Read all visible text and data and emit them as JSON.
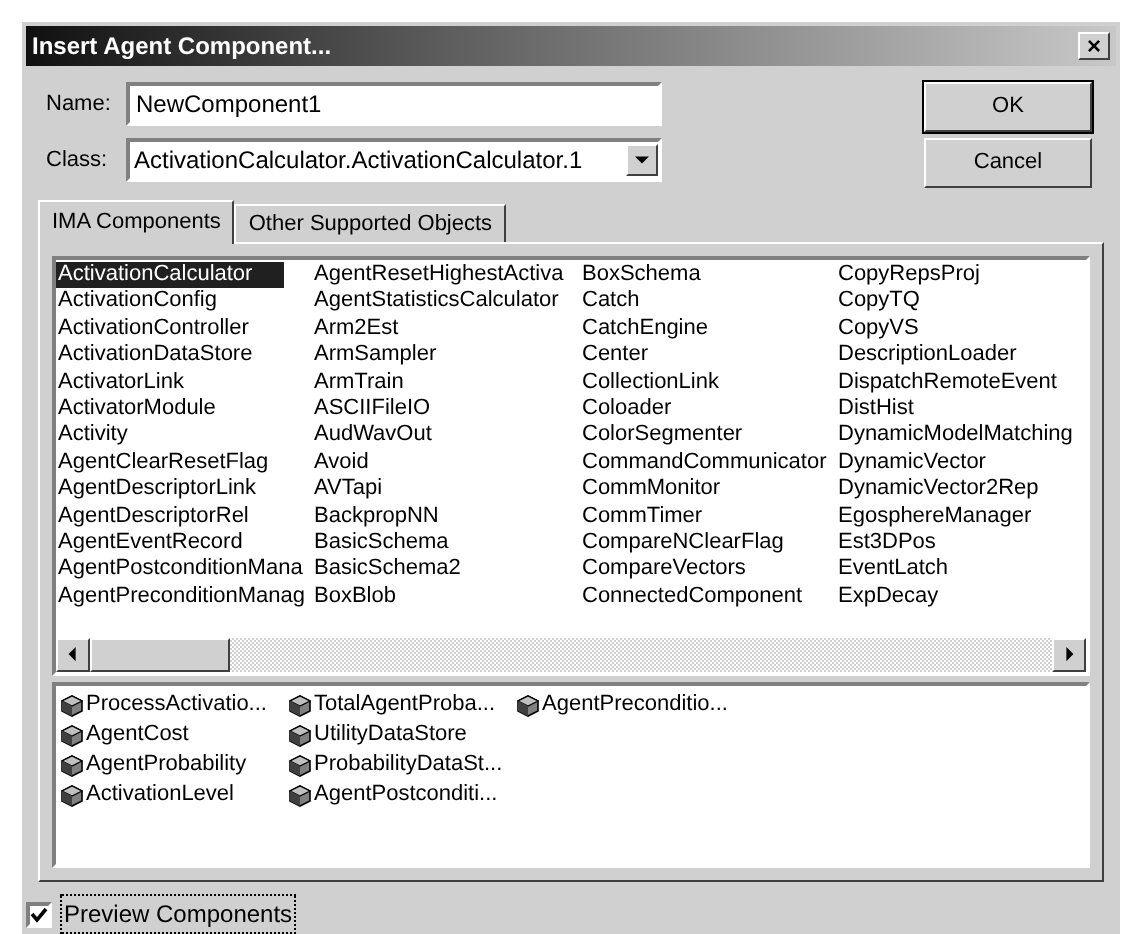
{
  "window": {
    "title": "Insert Agent Component...",
    "close": "×"
  },
  "name_field": {
    "label": "Name:",
    "value": "NewComponent1"
  },
  "class_field": {
    "label": "Class:",
    "value": "ActivationCalculator.ActivationCalculator.1"
  },
  "buttons": [
    "OK",
    "Cancel"
  ],
  "tabs": [
    {
      "label": "IMA Components",
      "selected": true
    },
    {
      "label": "Other Supported Objects",
      "selected": false
    }
  ],
  "component_list": {
    "columns": [
      [
        {
          "label": "ActivationCalculator",
          "selected": true
        },
        {
          "label": "ActivationConfig",
          "selected": false
        },
        {
          "label": "ActivationController",
          "selected": false
        },
        {
          "label": "ActivationDataStore",
          "selected": false
        },
        {
          "label": "ActivatorLink",
          "selected": false
        },
        {
          "label": "ActivatorModule",
          "selected": false
        },
        {
          "label": "Activity",
          "selected": false
        },
        {
          "label": "AgentClearResetFlag",
          "selected": false
        },
        {
          "label": "AgentDescriptorLink",
          "selected": false
        },
        {
          "label": "AgentDescriptorRel",
          "selected": false
        },
        {
          "label": "AgentEventRecord",
          "selected": false
        },
        {
          "label": "AgentPostconditionMana",
          "selected": false
        },
        {
          "label": "AgentPreconditionManag",
          "selected": false
        }
      ],
      [
        {
          "label": "AgentResetHighestActiva",
          "selected": false
        },
        {
          "label": "AgentStatisticsCalculator",
          "selected": false
        },
        {
          "label": "Arm2Est",
          "selected": false
        },
        {
          "label": "ArmSampler",
          "selected": false
        },
        {
          "label": "ArmTrain",
          "selected": false
        },
        {
          "label": "ASCIIFileIO",
          "selected": false
        },
        {
          "label": "AudWavOut",
          "selected": false
        },
        {
          "label": "Avoid",
          "selected": false
        },
        {
          "label": "AVTapi",
          "selected": false
        },
        {
          "label": "BackpropNN",
          "selected": false
        },
        {
          "label": "BasicSchema",
          "selected": false
        },
        {
          "label": "BasicSchema2",
          "selected": false
        },
        {
          "label": "BoxBlob",
          "selected": false
        }
      ],
      [
        {
          "label": "BoxSchema",
          "selected": false
        },
        {
          "label": "Catch",
          "selected": false
        },
        {
          "label": "CatchEngine",
          "selected": false
        },
        {
          "label": "Center",
          "selected": false
        },
        {
          "label": "CollectionLink",
          "selected": false
        },
        {
          "label": "Coloader",
          "selected": false
        },
        {
          "label": "ColorSegmenter",
          "selected": false
        },
        {
          "label": "CommandCommunicator",
          "selected": false
        },
        {
          "label": "CommMonitor",
          "selected": false
        },
        {
          "label": "CommTimer",
          "selected": false
        },
        {
          "label": "CompareNClearFlag",
          "selected": false
        },
        {
          "label": "CompareVectors",
          "selected": false
        },
        {
          "label": "ConnectedComponent",
          "selected": false
        }
      ],
      [
        {
          "label": "CopyRepsProj",
          "selected": false
        },
        {
          "label": "CopyTQ",
          "selected": false
        },
        {
          "label": "CopyVS",
          "selected": false
        },
        {
          "label": "DescriptionLoader",
          "selected": false
        },
        {
          "label": "DispatchRemoteEvent",
          "selected": false
        },
        {
          "label": "DistHist",
          "selected": false
        },
        {
          "label": "DynamicModelMatching",
          "selected": false
        },
        {
          "label": "DynamicVector",
          "selected": false
        },
        {
          "label": "DynamicVector2Rep",
          "selected": false
        },
        {
          "label": "EgosphereManager",
          "selected": false
        },
        {
          "label": "Est3DPos",
          "selected": false
        },
        {
          "label": "EventLatch",
          "selected": false
        },
        {
          "label": "ExpDecay",
          "selected": false
        }
      ]
    ]
  },
  "preview_list": {
    "columns": [
      [
        "ProcessActivatio...",
        "AgentCost",
        "AgentProbability",
        "ActivationLevel"
      ],
      [
        "TotalAgentProba...",
        "UtilityDataStore",
        "ProbabilityDataSt...",
        "AgentPostconditi..."
      ],
      [
        "AgentPreconditio..."
      ]
    ]
  },
  "preview_checkbox": {
    "label": "Preview Components",
    "checked": true
  }
}
